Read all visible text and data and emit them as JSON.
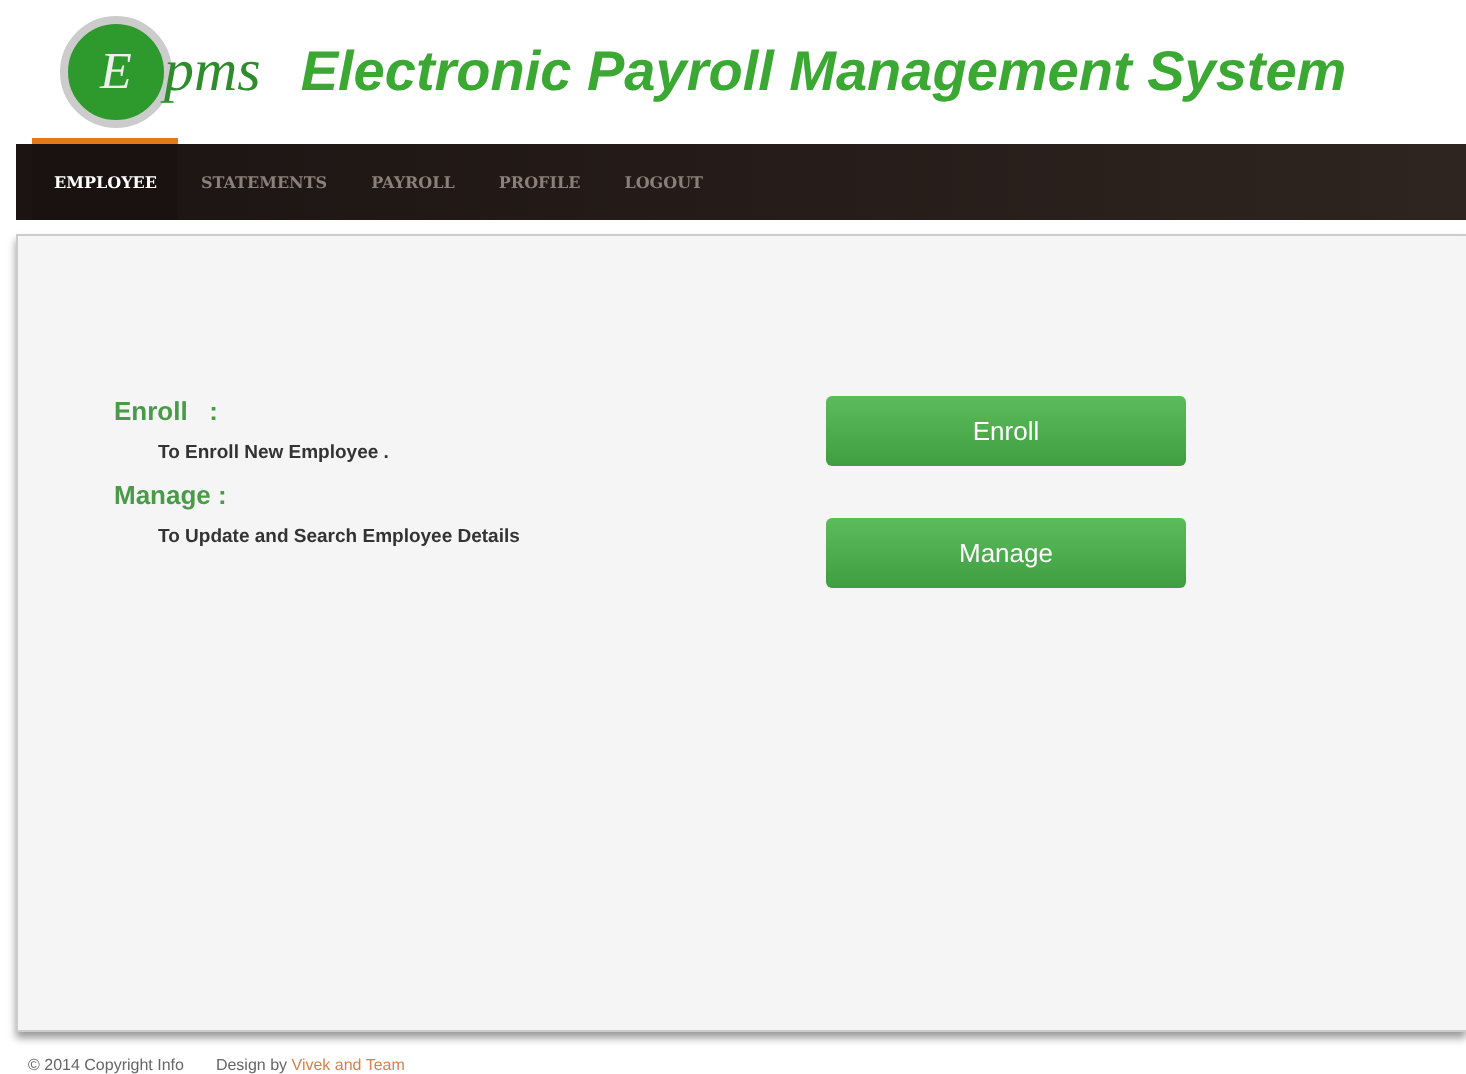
{
  "header": {
    "logo_letter": "E",
    "logo_text": "pms",
    "title": "Electronic Payroll Management System"
  },
  "nav": [
    {
      "label": "EMPLOYEE",
      "selected": true
    },
    {
      "label": "STATEMENTS",
      "selected": false
    },
    {
      "label": "PAYROLL",
      "selected": false
    },
    {
      "label": "PROFILE",
      "selected": false
    },
    {
      "label": "LOGOUT",
      "selected": false
    }
  ],
  "options": [
    {
      "heading": "Enroll   :",
      "description": "To Enroll New Employee .",
      "button": "Enroll"
    },
    {
      "heading": "Manage :",
      "description": "To Update and Search Employee Details",
      "button": "Manage"
    }
  ],
  "footer": {
    "copyright": "© 2014 Copyright Info",
    "design_prefix": "Design by",
    "design_link": "Vivek and Team"
  }
}
